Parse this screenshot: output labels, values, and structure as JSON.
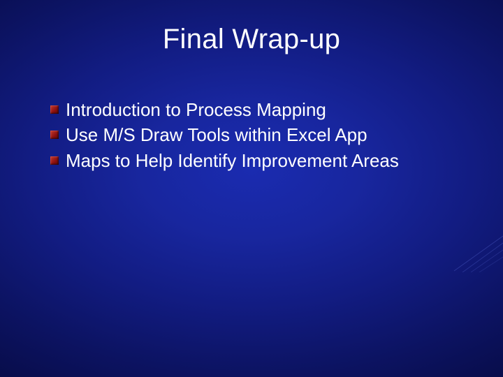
{
  "slide": {
    "title": "Final Wrap-up",
    "bullets": [
      "Introduction to Process Mapping",
      "Use M/S Draw Tools within Excel App",
      "Maps to Help Identify Improvement Areas"
    ]
  }
}
